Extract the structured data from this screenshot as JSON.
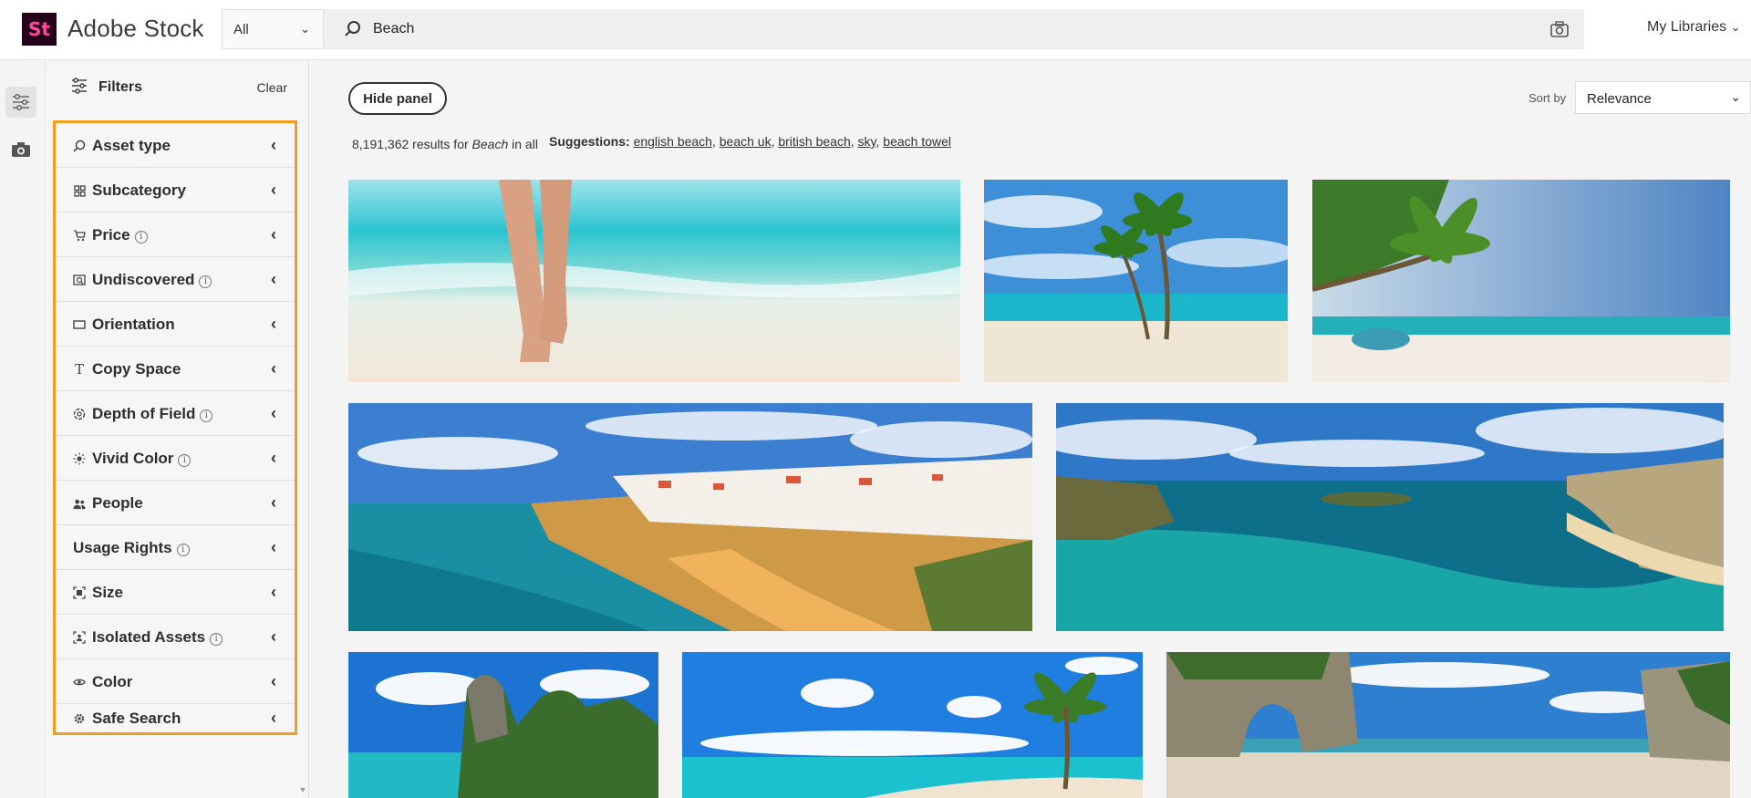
{
  "header": {
    "logo_mark": "St",
    "app_name": "Adobe Stock",
    "scope": "All",
    "search_value": "Beach",
    "my_libraries": "My Libraries"
  },
  "panel": {
    "title": "Filters",
    "clear": "Clear",
    "filters": [
      {
        "label": "Asset type",
        "icon": "search-icon",
        "info": false
      },
      {
        "label": "Subcategory",
        "icon": "grid-icon",
        "info": false
      },
      {
        "label": "Price",
        "icon": "cart-icon",
        "info": true
      },
      {
        "label": "Undiscovered",
        "icon": "discover-icon",
        "info": true
      },
      {
        "label": "Orientation",
        "icon": "rectangle-icon",
        "info": false
      },
      {
        "label": "Copy Space",
        "icon": "text-icon",
        "info": false
      },
      {
        "label": "Depth of Field",
        "icon": "aperture-icon",
        "info": true
      },
      {
        "label": "Vivid Color",
        "icon": "sun-icon",
        "info": true
      },
      {
        "label": "People",
        "icon": "people-icon",
        "info": false
      },
      {
        "label": "Usage Rights",
        "icon": "",
        "info": true
      },
      {
        "label": "Size",
        "icon": "size-icon",
        "info": false
      },
      {
        "label": "Isolated Assets",
        "icon": "isolated-icon",
        "info": true
      },
      {
        "label": "Color",
        "icon": "eye-icon",
        "info": false
      },
      {
        "label": "Safe Search",
        "icon": "gear-icon",
        "info": false
      }
    ]
  },
  "main": {
    "hide_panel": "Hide panel",
    "sort_by_label": "Sort by",
    "sort_value": "Relevance",
    "results_count": "8,191,362",
    "results_pre": " results for ",
    "results_query": "Beach",
    "results_post": " in all",
    "suggestions_label": "Suggestions:",
    "suggestions": [
      "english beach",
      "beach uk",
      "british beach",
      "sky",
      "beach towel"
    ]
  },
  "images": [
    {
      "subject": "feet-walking-in-surf"
    },
    {
      "subject": "two-palm-trees-on-beach"
    },
    {
      "subject": "palm-tree-with-swing"
    },
    {
      "subject": "cliff-town-beach-aerial"
    },
    {
      "subject": "turquoise-bay-aerial"
    },
    {
      "subject": "limestone-islands"
    },
    {
      "subject": "palm-beach-clouds"
    },
    {
      "subject": "rock-arch-beach"
    }
  ],
  "colors": {
    "accent_outline": "#f39c1d",
    "logo_bg": "#25011c",
    "logo_fg": "#ff4a9b"
  }
}
